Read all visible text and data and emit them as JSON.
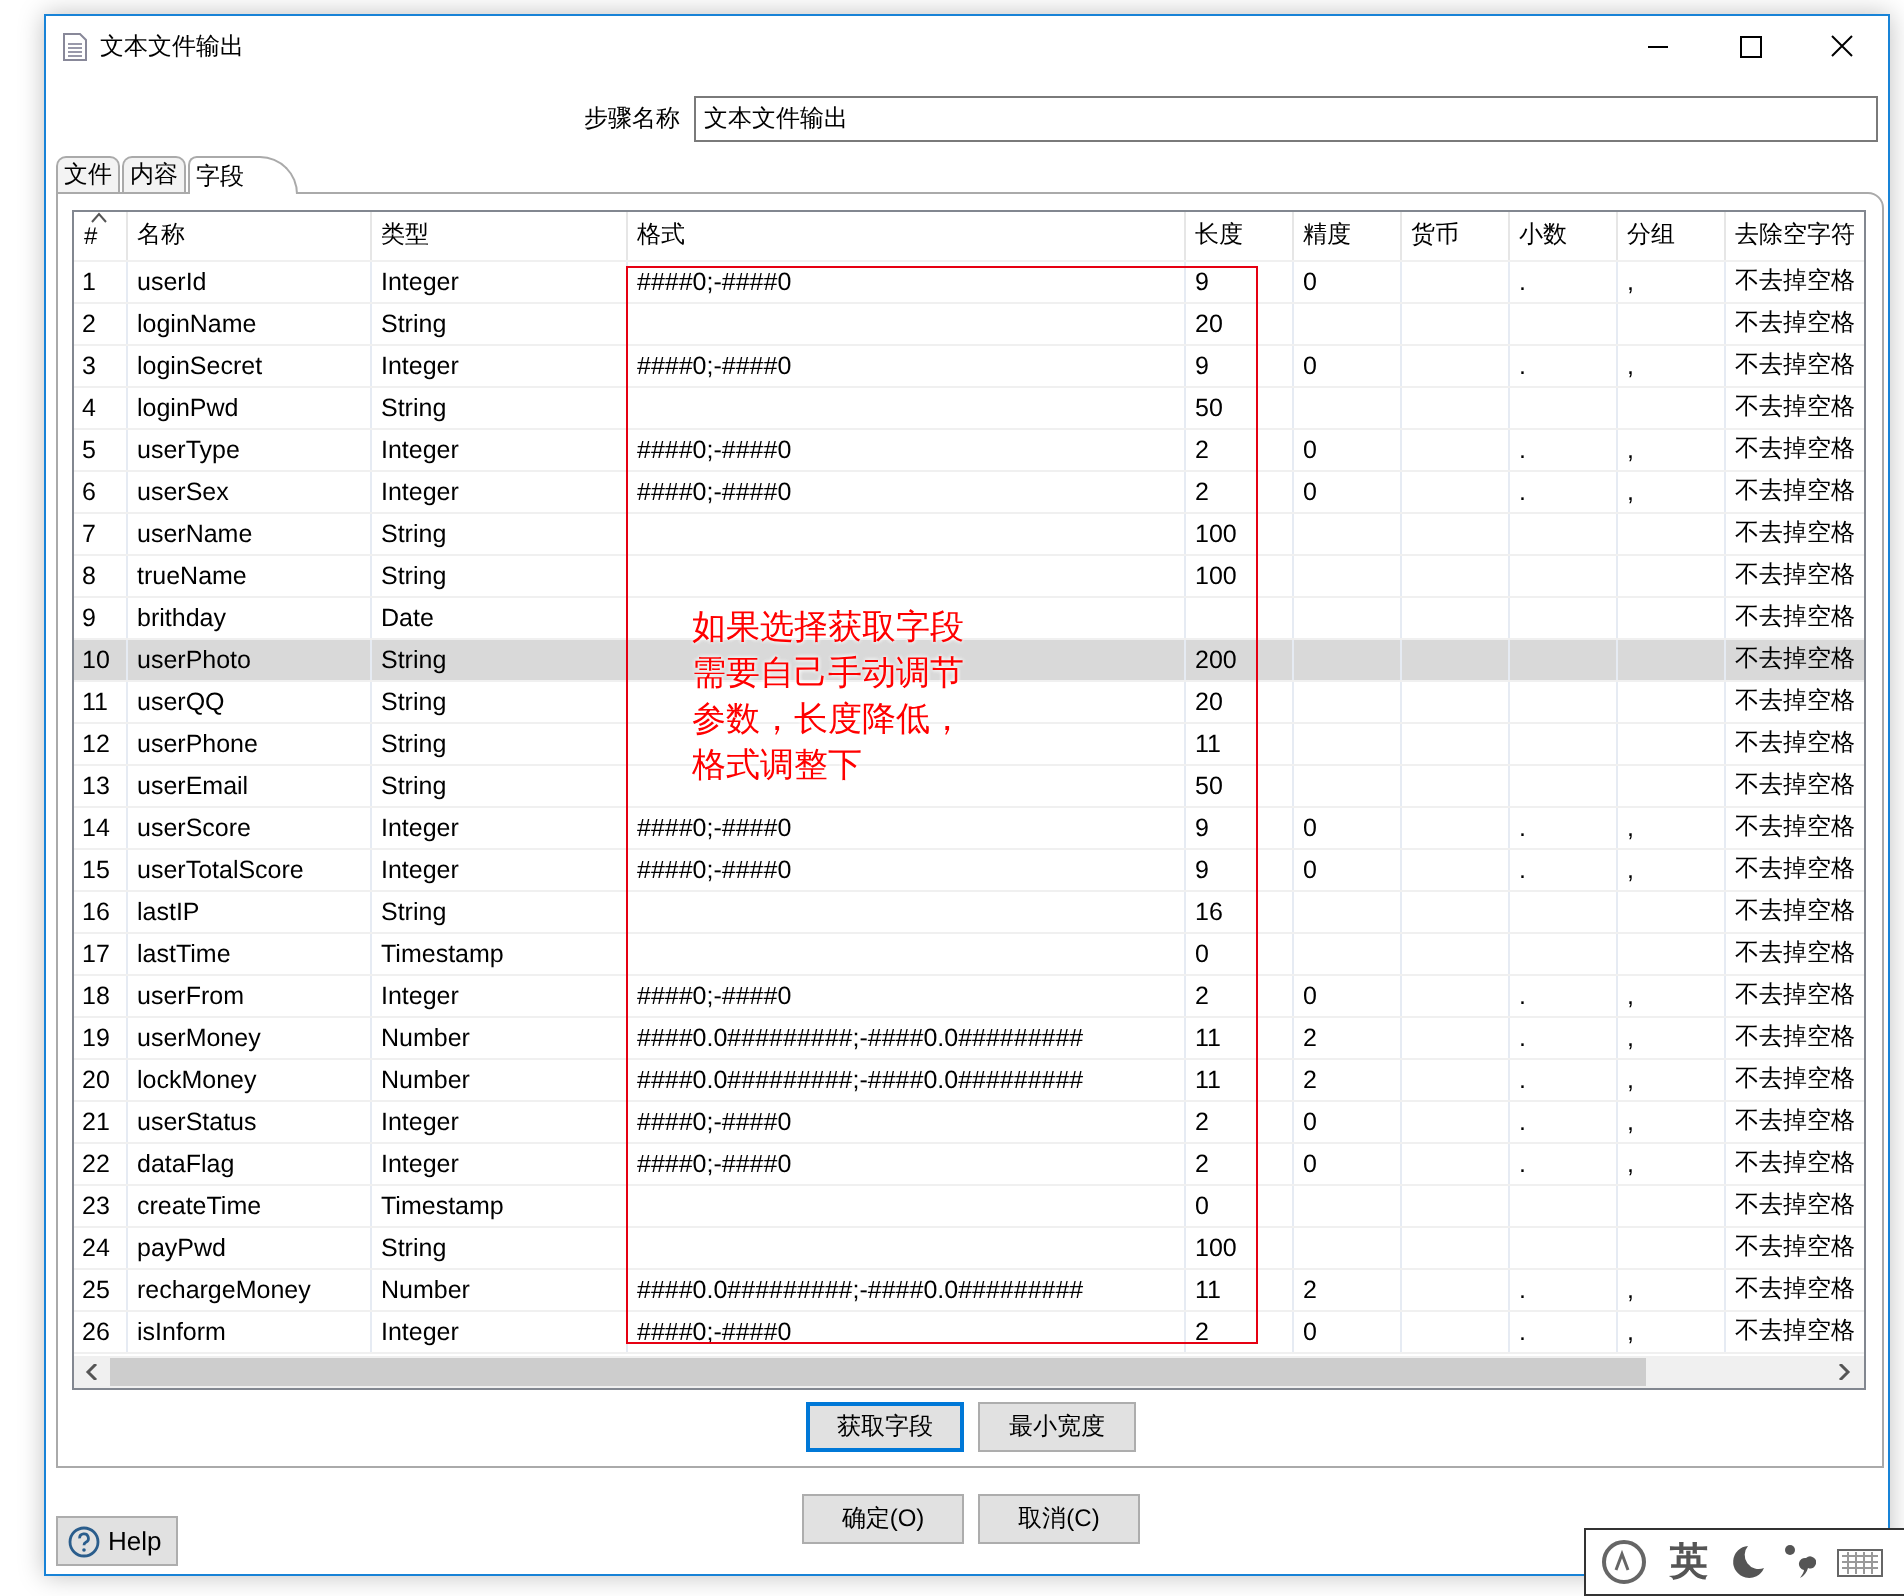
{
  "window": {
    "title": "文本文件输出"
  },
  "step_name": {
    "label": "步骤名称",
    "value": "文本文件输出"
  },
  "tabs": [
    {
      "label": "文件",
      "selected": false
    },
    {
      "label": "内容",
      "selected": false
    },
    {
      "label": "字段",
      "selected": true
    }
  ],
  "table": {
    "columns": [
      "#",
      "名称",
      "类型",
      "格式",
      "长度",
      "精度",
      "货币",
      "小数",
      "分组",
      "去除空字符"
    ],
    "rows": [
      {
        "cells": [
          "1",
          "userId",
          "Integer",
          "####0;-####0",
          "9",
          "0",
          null,
          ".",
          ",",
          "不去掉空格"
        ],
        "selected": false
      },
      {
        "cells": [
          "2",
          "loginName",
          "String",
          null,
          "20",
          null,
          null,
          null,
          null,
          "不去掉空格"
        ],
        "selected": false
      },
      {
        "cells": [
          "3",
          "loginSecret",
          "Integer",
          "####0;-####0",
          "9",
          "0",
          null,
          ".",
          ",",
          "不去掉空格"
        ],
        "selected": false
      },
      {
        "cells": [
          "4",
          "loginPwd",
          "String",
          null,
          "50",
          null,
          null,
          null,
          null,
          "不去掉空格"
        ],
        "selected": false
      },
      {
        "cells": [
          "5",
          "userType",
          "Integer",
          "####0;-####0",
          "2",
          "0",
          null,
          ".",
          ",",
          "不去掉空格"
        ],
        "selected": false
      },
      {
        "cells": [
          "6",
          "userSex",
          "Integer",
          "####0;-####0",
          "2",
          "0",
          null,
          ".",
          ",",
          "不去掉空格"
        ],
        "selected": false
      },
      {
        "cells": [
          "7",
          "userName",
          "String",
          null,
          "100",
          null,
          null,
          null,
          null,
          "不去掉空格"
        ],
        "selected": false
      },
      {
        "cells": [
          "8",
          "trueName",
          "String",
          null,
          "100",
          null,
          null,
          null,
          null,
          "不去掉空格"
        ],
        "selected": false
      },
      {
        "cells": [
          "9",
          "brithday",
          "Date",
          null,
          null,
          null,
          null,
          null,
          null,
          "不去掉空格"
        ],
        "selected": false
      },
      {
        "cells": [
          "10",
          "userPhoto",
          "String",
          null,
          "200",
          null,
          null,
          null,
          null,
          "不去掉空格"
        ],
        "selected": true
      },
      {
        "cells": [
          "11",
          "userQQ",
          "String",
          null,
          "20",
          null,
          null,
          null,
          null,
          "不去掉空格"
        ],
        "selected": false
      },
      {
        "cells": [
          "12",
          "userPhone",
          "String",
          null,
          "11",
          null,
          null,
          null,
          null,
          "不去掉空格"
        ],
        "selected": false
      },
      {
        "cells": [
          "13",
          "userEmail",
          "String",
          null,
          "50",
          null,
          null,
          null,
          null,
          "不去掉空格"
        ],
        "selected": false
      },
      {
        "cells": [
          "14",
          "userScore",
          "Integer",
          "####0;-####0",
          "9",
          "0",
          null,
          ".",
          ",",
          "不去掉空格"
        ],
        "selected": false
      },
      {
        "cells": [
          "15",
          "userTotalScore",
          "Integer",
          "####0;-####0",
          "9",
          "0",
          null,
          ".",
          ",",
          "不去掉空格"
        ],
        "selected": false
      },
      {
        "cells": [
          "16",
          "lastIP",
          "String",
          null,
          "16",
          null,
          null,
          null,
          null,
          "不去掉空格"
        ],
        "selected": false
      },
      {
        "cells": [
          "17",
          "lastTime",
          "Timestamp",
          null,
          "0",
          null,
          null,
          null,
          null,
          "不去掉空格"
        ],
        "selected": false
      },
      {
        "cells": [
          "18",
          "userFrom",
          "Integer",
          "####0;-####0",
          "2",
          "0",
          null,
          ".",
          ",",
          "不去掉空格"
        ],
        "selected": false
      },
      {
        "cells": [
          "19",
          "userMoney",
          "Number",
          "####0.0#########;-####0.0#########",
          "11",
          "2",
          null,
          ".",
          ",",
          "不去掉空格"
        ],
        "selected": false
      },
      {
        "cells": [
          "20",
          "lockMoney",
          "Number",
          "####0.0#########;-####0.0#########",
          "11",
          "2",
          null,
          ".",
          ",",
          "不去掉空格"
        ],
        "selected": false
      },
      {
        "cells": [
          "21",
          "userStatus",
          "Integer",
          "####0;-####0",
          "2",
          "0",
          null,
          ".",
          ",",
          "不去掉空格"
        ],
        "selected": false
      },
      {
        "cells": [
          "22",
          "dataFlag",
          "Integer",
          "####0;-####0",
          "2",
          "0",
          null,
          ".",
          ",",
          "不去掉空格"
        ],
        "selected": false
      },
      {
        "cells": [
          "23",
          "createTime",
          "Timestamp",
          null,
          "0",
          null,
          null,
          null,
          null,
          "不去掉空格"
        ],
        "selected": false
      },
      {
        "cells": [
          "24",
          "payPwd",
          "String",
          null,
          "100",
          null,
          null,
          null,
          null,
          "不去掉空格"
        ],
        "selected": false
      },
      {
        "cells": [
          "25",
          "rechargeMoney",
          "Number",
          "####0.0#########;-####0.0#########",
          "11",
          "2",
          null,
          ".",
          ",",
          "不去掉空格"
        ],
        "selected": false
      },
      {
        "cells": [
          "26",
          "isInform",
          "Integer",
          "####0;-####0",
          "2",
          "0",
          null,
          ".",
          ",",
          "不去掉空格"
        ],
        "selected": false
      }
    ]
  },
  "annotation": {
    "lines": [
      "如果选择获取字段",
      "需要自己手动调节",
      "参数，长度降低，",
      "格式调整下"
    ]
  },
  "table_buttons": [
    {
      "label": "获取字段",
      "focused": true
    },
    {
      "label": "最小宽度",
      "focused": false
    }
  ],
  "help_button": {
    "label": "Help"
  },
  "dialog_buttons": [
    {
      "label": "确定(O)"
    },
    {
      "label": "取消(C)"
    }
  ],
  "ime_bar": {
    "mode": "英"
  }
}
